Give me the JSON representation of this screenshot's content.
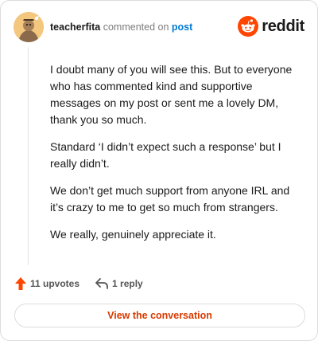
{
  "header": {
    "username": "teacherfita",
    "action_text": "commented on",
    "post_link": "post",
    "brand": "reddit",
    "brand_color": "#ff4500",
    "icons": {
      "avatar": "user-avatar",
      "logo": "reddit-logo-icon"
    }
  },
  "comment": {
    "paragraphs": [
      "I doubt many of you will see this. But to everyone who has commented kind and supportive messages on my post or sent me a lovely DM, thank you so much.",
      "Standard ‘I didn’t expect such a response’ but I really didn’t.",
      "We don’t get much support from anyone IRL and it’s crazy to me to get so much from strangers.",
      "We really, genuinely appreciate it."
    ]
  },
  "actions": {
    "upvotes": "11 upvotes",
    "replies": "1 reply",
    "icons": {
      "upvote": "upvote-arrow-icon",
      "reply": "reply-arrow-icon"
    },
    "upvote_color": "#ff4500"
  },
  "footer": {
    "button_label": "View the conversation",
    "button_color": "#d93a00"
  }
}
